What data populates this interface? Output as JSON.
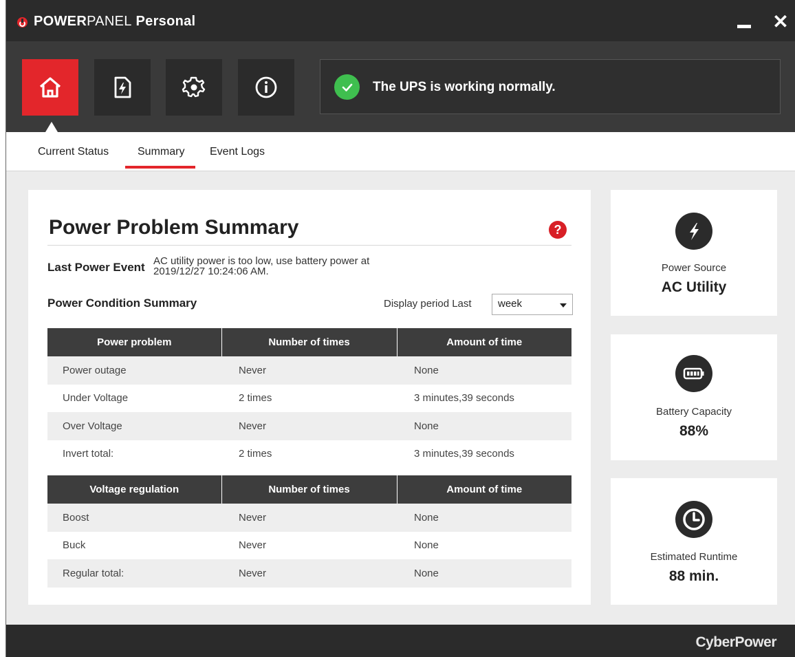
{
  "titlebar": {
    "brand_bold": "POWER",
    "brand_light": "PANEL",
    "brand_suffix": " Personal",
    "minimize": "minimize",
    "close": "✕"
  },
  "toolbar": {
    "nav": [
      {
        "name": "home",
        "icon": "home-icon"
      },
      {
        "name": "power-event",
        "icon": "power-file-icon"
      },
      {
        "name": "settings",
        "icon": "gear-icon"
      },
      {
        "name": "information",
        "icon": "info-icon"
      }
    ],
    "status_text": "The UPS is working normally."
  },
  "tabs": [
    "Current Status",
    "Summary",
    "Event Logs"
  ],
  "active_tab": "Summary",
  "summary": {
    "title": "Power Problem Summary",
    "last_event_label": "Last Power Event",
    "last_event_value": "AC utility power is too low, use battery power at 2019/12/27 10:24:06 AM.",
    "condition_label": "Power Condition Summary",
    "period_label": "Display period Last",
    "period_value": "week",
    "problems_table": {
      "headers": [
        "Power problem",
        "Number of times",
        "Amount of time"
      ],
      "rows": [
        [
          "Power outage",
          "Never",
          "None"
        ],
        [
          "Under Voltage",
          "2 times",
          "3 minutes,39 seconds"
        ],
        [
          "Over Voltage",
          "Never",
          "None"
        ],
        [
          "Invert total:",
          "2 times",
          "3 minutes,39 seconds"
        ]
      ]
    },
    "regulation_table": {
      "headers": [
        "Voltage regulation",
        "Number of times",
        "Amount of time"
      ],
      "rows": [
        [
          "Boost",
          "Never",
          "None"
        ],
        [
          "Buck",
          "Never",
          "None"
        ],
        [
          "Regular total:",
          "Never",
          "None"
        ]
      ]
    }
  },
  "side": {
    "power_source": {
      "label": "Power Source",
      "value": "AC Utility",
      "icon": "lightning-icon"
    },
    "battery": {
      "label": "Battery Capacity",
      "value": "88%",
      "icon": "battery-icon"
    },
    "runtime": {
      "label": "Estimated Runtime",
      "value": "88 min.",
      "icon": "clock-icon"
    }
  },
  "footer": {
    "brand": "CyberPower"
  },
  "colors": {
    "accent": "#e3262b",
    "ok": "#3fbf4f",
    "dark": "#2b2b2b"
  }
}
